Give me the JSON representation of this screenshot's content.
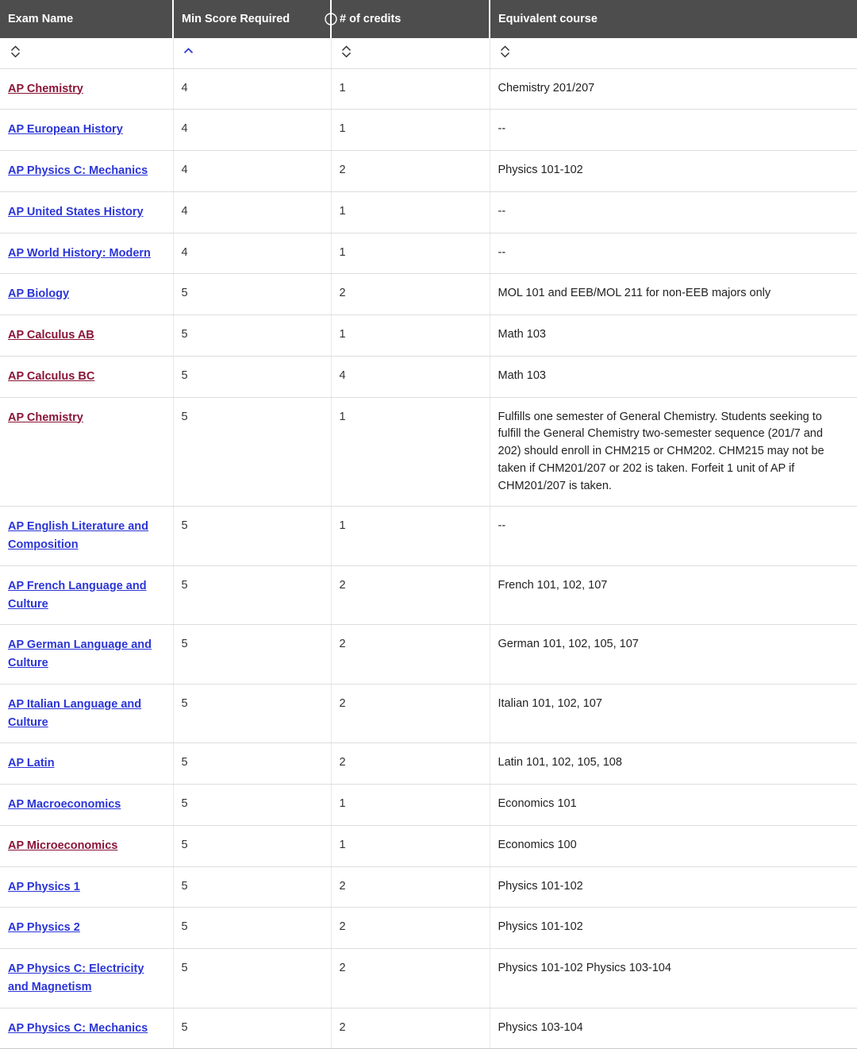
{
  "table": {
    "columns": [
      {
        "key": "exam_name",
        "label": "Exam Name",
        "sort": "none",
        "has_info_icon": false
      },
      {
        "key": "min_score",
        "label": "Min Score Required",
        "sort": "asc",
        "has_info_icon": true,
        "info_icon": "info-circle-icon"
      },
      {
        "key": "credits",
        "label": "# of credits",
        "sort": "none",
        "has_info_icon": false
      },
      {
        "key": "equivalent_course",
        "label": "Equivalent course",
        "sort": "none",
        "has_info_icon": false
      }
    ],
    "colors": {
      "header_background": "#4d4d4d",
      "header_text": "#ffffff",
      "link": "#2b35d6",
      "link_visited": "#8a1538",
      "sort_active": "#2b35d6",
      "sort_inactive": "#333333",
      "row_border": "#dddddd"
    },
    "rows": [
      {
        "exam_name": "AP Chemistry",
        "visited": true,
        "min_score": "4",
        "credits": "1",
        "equivalent_course": "Chemistry 201/207"
      },
      {
        "exam_name": "AP European History",
        "visited": false,
        "min_score": "4",
        "credits": "1",
        "equivalent_course": "--"
      },
      {
        "exam_name": "AP Physics C: Mechanics",
        "visited": false,
        "min_score": "4",
        "credits": "2",
        "equivalent_course": "Physics 101-102"
      },
      {
        "exam_name": "AP United States History",
        "visited": false,
        "min_score": "4",
        "credits": "1",
        "equivalent_course": "--"
      },
      {
        "exam_name": "AP World History: Modern",
        "visited": false,
        "min_score": "4",
        "credits": "1",
        "equivalent_course": "--"
      },
      {
        "exam_name": "AP Biology",
        "visited": false,
        "min_score": "5",
        "credits": "2",
        "equivalent_course": "MOL 101 and EEB/MOL 211 for non-EEB majors only"
      },
      {
        "exam_name": "AP Calculus AB",
        "visited": true,
        "min_score": "5",
        "credits": "1",
        "equivalent_course": "Math 103"
      },
      {
        "exam_name": "AP Calculus BC",
        "visited": true,
        "min_score": "5",
        "credits": "4",
        "equivalent_course": "Math 103"
      },
      {
        "exam_name": "AP Chemistry",
        "visited": true,
        "min_score": "5",
        "credits": "1",
        "equivalent_course": "Fulfills one semester of General Chemistry. Students seeking to fulfill the General Chemistry two-semester sequence (201/7 and 202) should enroll in CHM215 or CHM202. CHM215 may not be taken if CHM201/207 or 202 is taken. Forfeit 1 unit of AP if CHM201/207 is taken."
      },
      {
        "exam_name": "AP English Literature and Composition",
        "visited": false,
        "min_score": "5",
        "credits": "1",
        "equivalent_course": "--"
      },
      {
        "exam_name": "AP French Language and Culture",
        "visited": false,
        "min_score": "5",
        "credits": "2",
        "equivalent_course": "French 101, 102, 107"
      },
      {
        "exam_name": "AP German Language and Culture",
        "visited": false,
        "min_score": "5",
        "credits": "2",
        "equivalent_course": "German 101, 102, 105, 107"
      },
      {
        "exam_name": "AP Italian Language and Culture",
        "visited": false,
        "min_score": "5",
        "credits": "2",
        "equivalent_course": "Italian 101, 102, 107"
      },
      {
        "exam_name": "AP Latin",
        "visited": false,
        "min_score": "5",
        "credits": "2",
        "equivalent_course": "Latin 101, 102, 105, 108"
      },
      {
        "exam_name": "AP Macroeconomics",
        "visited": false,
        "min_score": "5",
        "credits": "1",
        "equivalent_course": "Economics 101"
      },
      {
        "exam_name": "AP Microeconomics",
        "visited": true,
        "min_score": "5",
        "credits": "1",
        "equivalent_course": "Economics 100"
      },
      {
        "exam_name": "AP Physics 1",
        "visited": false,
        "min_score": "5",
        "credits": "2",
        "equivalent_course": "Physics 101-102"
      },
      {
        "exam_name": "AP Physics 2",
        "visited": false,
        "min_score": "5",
        "credits": "2",
        "equivalent_course": "Physics 101-102"
      },
      {
        "exam_name": "AP Physics C: Electricity and Magnetism",
        "visited": false,
        "min_score": "5",
        "credits": "2",
        "equivalent_course": "Physics 101-102 Physics 103-104"
      },
      {
        "exam_name": "AP Physics C: Mechanics",
        "visited": false,
        "min_score": "5",
        "credits": "2",
        "equivalent_course": "Physics 103-104"
      }
    ]
  }
}
